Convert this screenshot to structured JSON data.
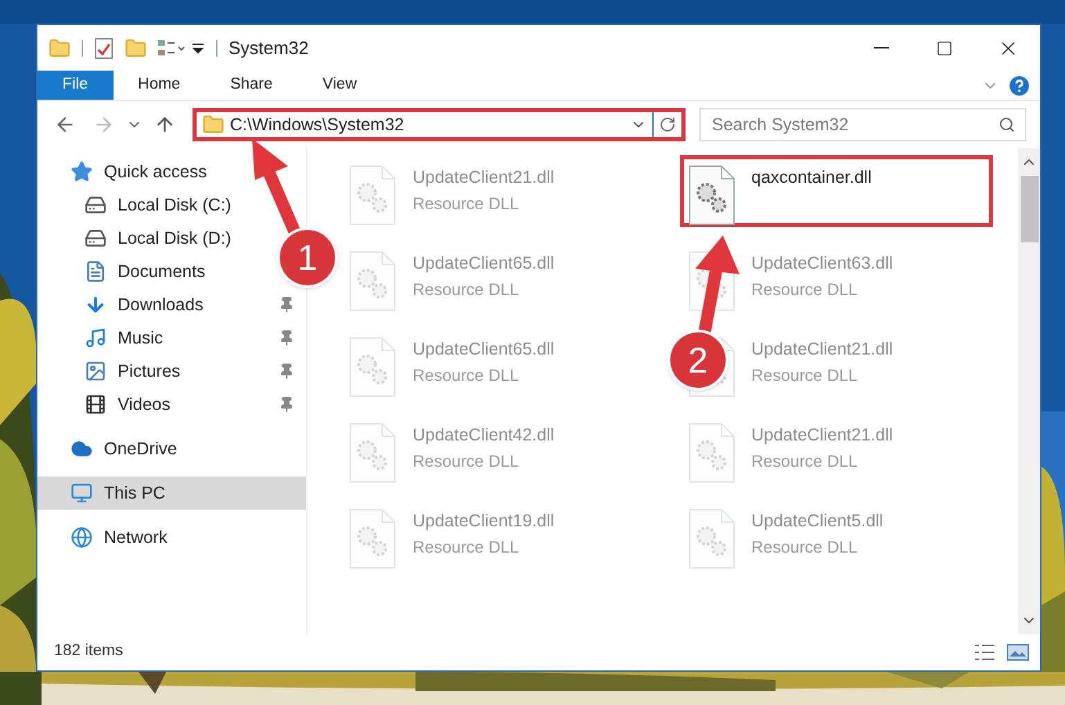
{
  "window": {
    "title": "System32"
  },
  "ribbon": {
    "tabs": [
      {
        "label": "File",
        "selected": true
      },
      {
        "label": "Home",
        "selected": false
      },
      {
        "label": "Share",
        "selected": false
      },
      {
        "label": "View",
        "selected": false
      }
    ]
  },
  "address": {
    "path": "C:\\Windows\\System32",
    "highlighted": true
  },
  "search": {
    "placeholder": "Search System32"
  },
  "sidebar": {
    "items": [
      {
        "label": "Quick access",
        "kind": "star",
        "selected": false,
        "children": [
          {
            "label": "Local Disk (C:)",
            "kind": "drive",
            "pinned": false,
            "selected": false
          },
          {
            "label": "Local Disk (D:)",
            "kind": "drive",
            "pinned": false,
            "selected": false
          },
          {
            "label": "Documents",
            "kind": "documents",
            "pinned": false,
            "selected": false
          },
          {
            "label": "Downloads",
            "kind": "downloads",
            "pinned": true,
            "selected": false
          },
          {
            "label": "Music",
            "kind": "music",
            "pinned": true,
            "selected": false
          },
          {
            "label": "Pictures",
            "kind": "pictures",
            "pinned": true,
            "selected": false
          },
          {
            "label": "Videos",
            "kind": "videos",
            "pinned": true,
            "selected": false
          }
        ]
      },
      {
        "label": "OneDrive",
        "kind": "cloud",
        "selected": false
      },
      {
        "label": "This PC",
        "kind": "pc",
        "selected": true
      },
      {
        "label": "Network",
        "kind": "network",
        "selected": false
      }
    ]
  },
  "files": [
    {
      "name": "UpdateClient21.dll",
      "type": "Resource DLL",
      "faded": true,
      "highlighted": false
    },
    {
      "name": "qaxcontainer.dll",
      "faded": false,
      "highlighted": true
    },
    {
      "name": "UpdateClient65.dll",
      "type": "Resource DLL",
      "faded": true,
      "highlighted": false
    },
    {
      "name": "UpdateClient63.dll",
      "type": "Resource DLL",
      "faded": true,
      "highlighted": false
    },
    {
      "name": "UpdateClient65.dll",
      "type": "Resource DLL",
      "faded": true,
      "highlighted": false
    },
    {
      "name": "UpdateClient21.dll",
      "type": "Resource DLL",
      "faded": true,
      "highlighted": false
    },
    {
      "name": "UpdateClient42.dll",
      "type": "Resource DLL",
      "faded": true,
      "highlighted": false
    },
    {
      "name": "UpdateClient21.dll",
      "type": "Resource DLL",
      "faded": true,
      "highlighted": false
    },
    {
      "name": "UpdateClient19.dll",
      "type": "Resource DLL",
      "faded": true,
      "highlighted": false
    },
    {
      "name": "UpdateClient5.dll",
      "type": "Resource DLL",
      "faded": true,
      "highlighted": false
    }
  ],
  "status_bar": {
    "count": "182 items"
  },
  "annotations": [
    {
      "number": "1"
    },
    {
      "number": "2"
    }
  ]
}
